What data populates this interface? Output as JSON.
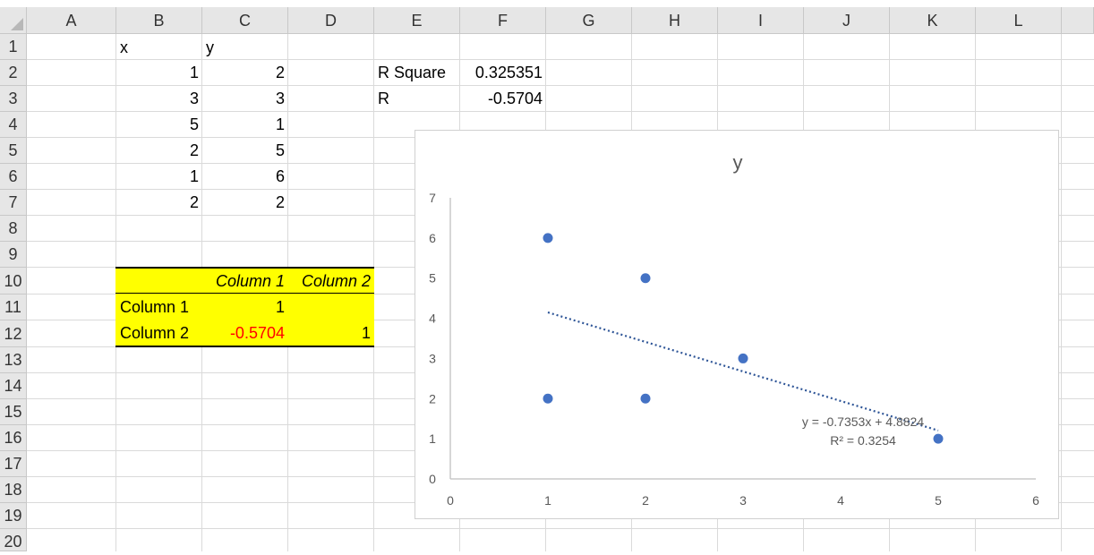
{
  "columns": [
    "A",
    "B",
    "C",
    "D",
    "E",
    "F",
    "G",
    "H",
    "I",
    "J",
    "K",
    "L"
  ],
  "rows": [
    "1",
    "2",
    "3",
    "4",
    "5",
    "6",
    "7",
    "8",
    "9",
    "10",
    "11",
    "12",
    "13",
    "14",
    "15",
    "16",
    "17",
    "18",
    "19",
    "20"
  ],
  "cells": {
    "B1": "x",
    "C1": "y",
    "B2": "1",
    "C2": "2",
    "B3": "3",
    "C3": "3",
    "B4": "5",
    "C4": "1",
    "B5": "2",
    "C5": "5",
    "B6": "1",
    "C6": "6",
    "B7": "2",
    "C7": "2",
    "E2": "R Square",
    "F2": "0.325351",
    "E3": "R",
    "F3": "-0.5704"
  },
  "corr_table": {
    "header": [
      "Column 1",
      "Column 2"
    ],
    "rows": [
      {
        "label": "Column 1",
        "c1": "1",
        "c2": ""
      },
      {
        "label": "Column 2",
        "c1": "-0.5704",
        "c2": "1"
      }
    ],
    "highlight_color": "#ffff00",
    "negative_color": "#ff0000"
  },
  "chart_data": {
    "type": "scatter",
    "title": "y",
    "xlabel": "",
    "ylabel": "",
    "xlim": [
      0,
      6
    ],
    "ylim": [
      0,
      7
    ],
    "xticks": [
      0,
      1,
      2,
      3,
      4,
      5,
      6
    ],
    "yticks": [
      0,
      1,
      2,
      3,
      4,
      5,
      6,
      7
    ],
    "grid": false,
    "series": [
      {
        "x": [
          1,
          3,
          5,
          2,
          1,
          2
        ],
        "y": [
          2,
          3,
          1,
          5,
          6,
          2
        ],
        "color": "#4472c4"
      }
    ],
    "trendline": {
      "type": "linear",
      "slope": -0.7353,
      "intercept": 4.8824,
      "x_range": [
        1,
        5
      ],
      "style": "dotted",
      "color": "#2e5597",
      "equation_label": "y = -0.7353x + 4.8824",
      "r2_label": "R² = 0.3254"
    }
  }
}
